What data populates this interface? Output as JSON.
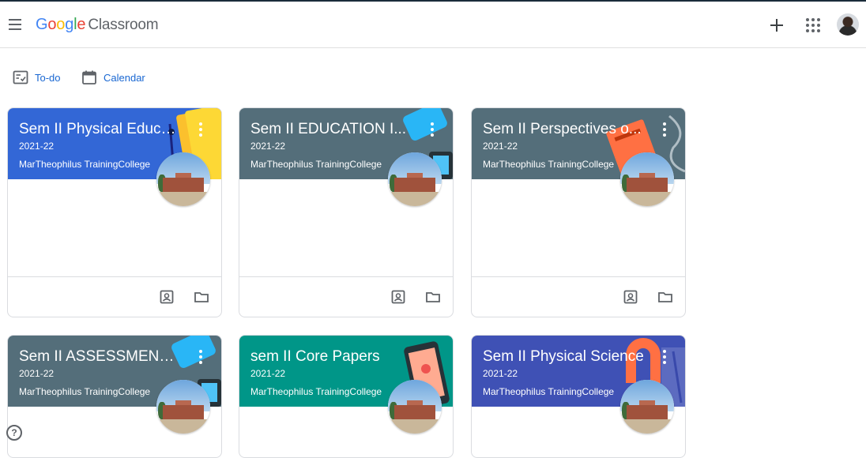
{
  "app": {
    "logo_letters": [
      {
        "char": "G",
        "color": "#4285F4"
      },
      {
        "char": "o",
        "color": "#EA4335"
      },
      {
        "char": "o",
        "color": "#FBBC05"
      },
      {
        "char": "g",
        "color": "#4285F4"
      },
      {
        "char": "l",
        "color": "#34A853"
      },
      {
        "char": "e",
        "color": "#EA4335"
      }
    ],
    "product_name": "Classroom"
  },
  "header": {
    "menu_icon": "hamburger-menu-icon",
    "create_icon": "plus-icon",
    "apps_icon": "grid-apps-icon"
  },
  "subnav": {
    "todo_label": "To-do",
    "calendar_label": "Calendar"
  },
  "colors": {
    "accent": "#1967d2",
    "banner_blue": "#3367d6",
    "banner_grey": "#546e7a",
    "banner_teal": "#009688",
    "banner_indigo": "#3f51b5"
  },
  "classes": [
    {
      "title": "Sem II Physical Educa...",
      "section": "2021-22",
      "owner": "MarTheophilus TrainingCollege",
      "banner_color": "#3367d6"
    },
    {
      "title": "Sem II EDUCATION I...",
      "section": "2021-22",
      "owner": "MarTheophilus TrainingCollege",
      "banner_color": "#546e7a"
    },
    {
      "title": "Sem II Perspectives o...",
      "section": "2021-22",
      "owner": "MarTheophilus TrainingCollege",
      "banner_color": "#546e7a"
    },
    {
      "title": "Sem II ASSESSMENT I...",
      "section": "2021-22",
      "owner": "MarTheophilus TrainingCollege",
      "banner_color": "#546e7a"
    },
    {
      "title": "sem II Core Papers",
      "section": "2021-22",
      "owner": "MarTheophilus TrainingCollege",
      "banner_color": "#009688"
    },
    {
      "title": "Sem II Physical Science",
      "section": "2021-22",
      "owner": "MarTheophilus TrainingCollege",
      "banner_color": "#3f51b5"
    }
  ],
  "card_icons": {
    "assignments_icon": "assignment-ind-icon",
    "folder_icon": "folder-icon"
  },
  "help": {
    "label": "?"
  }
}
